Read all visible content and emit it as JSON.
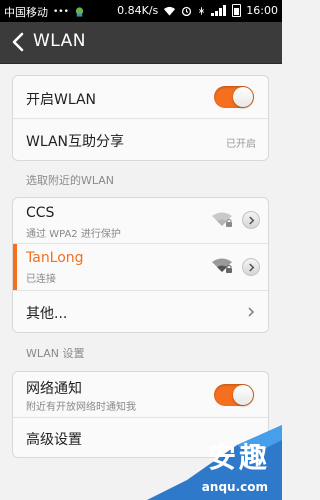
{
  "statusbar": {
    "carrier": "中国移动",
    "dots": "•••",
    "speed": "0.84K/s",
    "time": "16:00"
  },
  "header": {
    "title": "WLAN"
  },
  "settings": {
    "enable_wlan_label": "开启WLAN",
    "enable_wlan_on": true,
    "assist_share_label": "WLAN互助分享",
    "assist_share_value": "已开启"
  },
  "nearby": {
    "section_title": "选取附近的WLAN",
    "networks": [
      {
        "ssid": "CCS",
        "status": "通过 WPA2 进行保护",
        "active": false
      },
      {
        "ssid": "TanLong",
        "status": "已连接",
        "active": true
      }
    ],
    "other_label": "其他..."
  },
  "wlan_settings": {
    "section_title": "WLAN 设置",
    "network_notify_label": "网络通知",
    "network_notify_desc": "附近有开放网络时通知我",
    "network_notify_on": true,
    "advanced_label": "高级设置"
  },
  "watermark": {
    "text": "安趣",
    "url": "anqu.com"
  },
  "colors": {
    "accent": "#f56f1e",
    "titlebar": "#3b3b3b",
    "background": "#f2f2f2"
  }
}
